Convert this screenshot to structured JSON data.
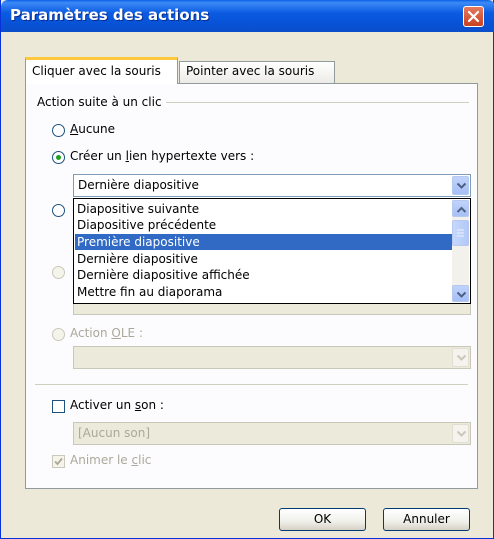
{
  "window": {
    "title": "Paramètres des actions"
  },
  "tabs": [
    {
      "label": "Cliquer avec la souris"
    },
    {
      "label": "Pointer avec la souris"
    }
  ],
  "group": {
    "label": "Action suite à un clic"
  },
  "options": {
    "none": {
      "label_u": "A",
      "label_rest": "ucune",
      "selected": false
    },
    "hyperlink": {
      "label_pre": "Créer un ",
      "label_u": "l",
      "label_post": "ien hypertexte vers :",
      "selected": true
    },
    "ole": {
      "label_pre": "Action ",
      "label_u": "O",
      "label_post": "LE :",
      "enabled": false
    }
  },
  "hyperlink_combo": {
    "value": "Dernière diapositive"
  },
  "dropdown": {
    "items": [
      "Diapositive suivante",
      "Diapositive précédente",
      "Première diapositive",
      "Dernière diapositive",
      "Dernière diapositive affichée",
      "Mettre fin au diaporama"
    ],
    "selected_index": 2
  },
  "sound": {
    "checkbox_pre": "Activer un ",
    "checkbox_u": "s",
    "checkbox_post": "on :",
    "checked": false,
    "combo_value": "[Aucun son]"
  },
  "animate": {
    "label_pre": "Animer le ",
    "label_u": "c",
    "label_post": "lic",
    "checked": true,
    "enabled": false
  },
  "buttons": {
    "ok": "OK",
    "cancel": "Annuler"
  },
  "colors": {
    "titlebar": "#0a5fe6",
    "selection": "#316ac5",
    "radio_dot": "#21a121",
    "close": "#c8401f"
  }
}
